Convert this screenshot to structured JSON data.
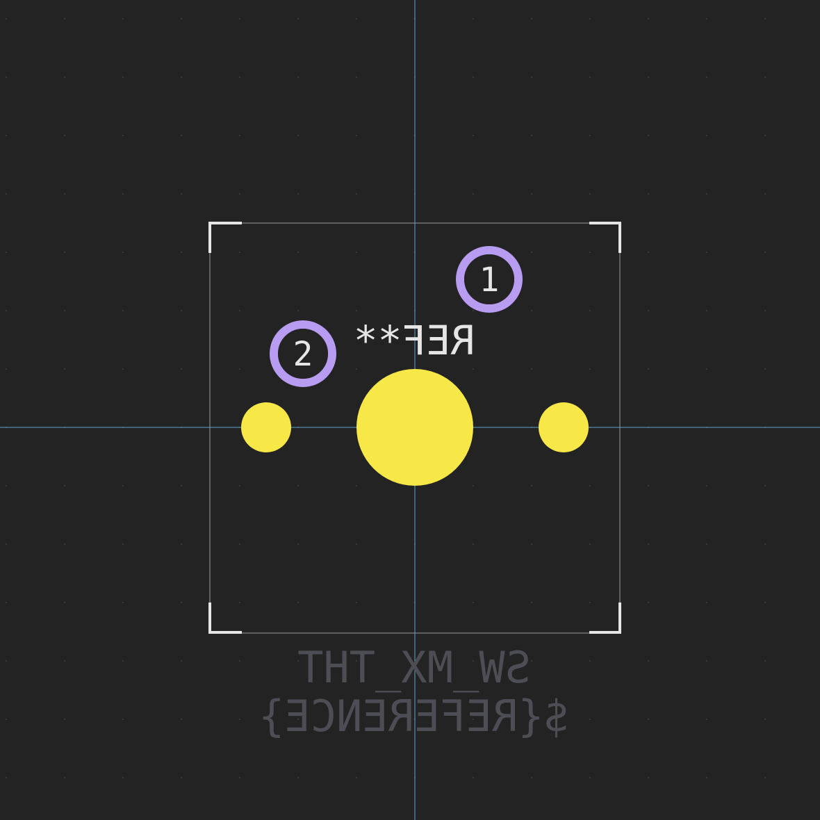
{
  "footprint": {
    "reference": "REF**",
    "value": "SW_MX_THT",
    "user_text": "${REFERENCE}",
    "pads": [
      {
        "number": "1"
      },
      {
        "number": "2"
      }
    ]
  },
  "colors": {
    "background": "#232323",
    "crosshair": "#5aa6c8",
    "courtyard": "#5f5f5f",
    "silkscreen": "#e6e6e6",
    "pad_ring": "#b79cf2",
    "pad_hole": "#232323",
    "npth_hole": "#f7e848",
    "fab_text": "#4d4d55",
    "grid_dot": "#3a3a3a"
  },
  "icons": {
    "pad": "through-hole-pad-icon",
    "hole": "mounting-hole-icon",
    "corner": "silkscreen-corner-mark"
  }
}
